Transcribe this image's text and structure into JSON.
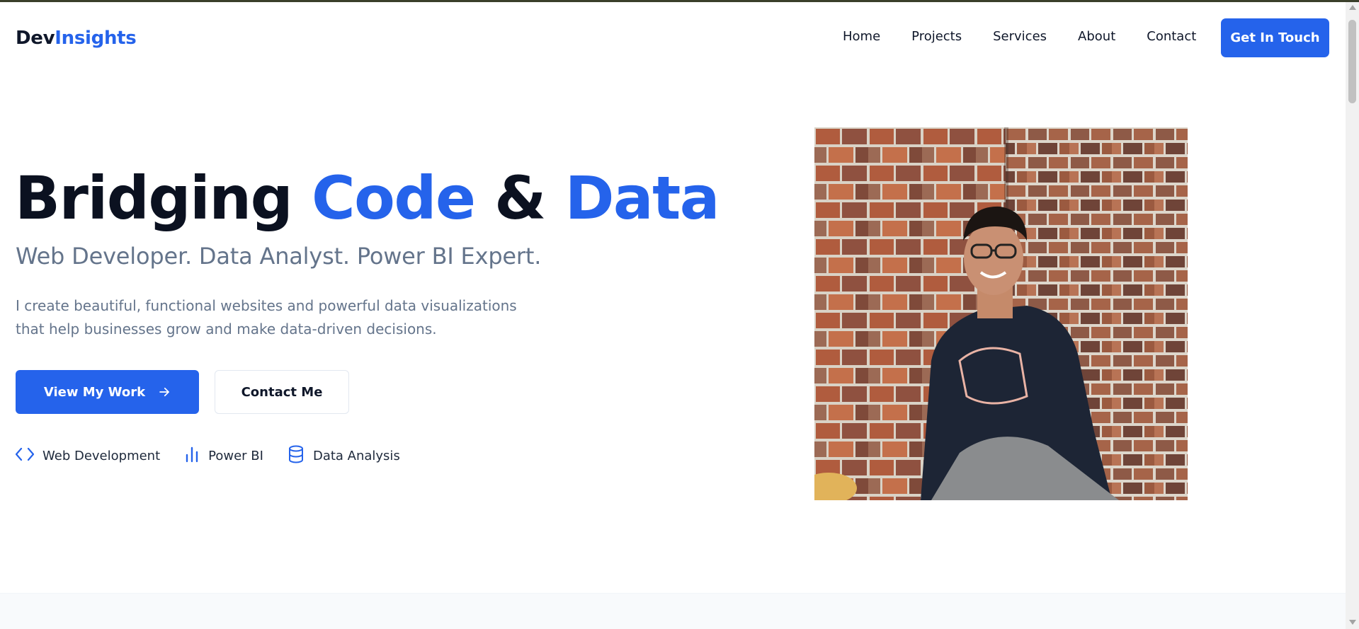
{
  "header": {
    "logo_part1": "Dev",
    "logo_part2": "Insights",
    "nav": [
      "Home",
      "Projects",
      "Services",
      "About",
      "Contact"
    ],
    "cta": "Get In Touch"
  },
  "hero": {
    "title_word1": "Bridging ",
    "title_word2": "Code",
    "title_word3": " & ",
    "title_word4": "Data",
    "subtitle": "Web Developer. Data Analyst. Power BI Expert.",
    "description": "I create beautiful, functional websites and powerful data visualizations that help businesses grow and make data-driven decisions.",
    "primary_button": "View My Work",
    "secondary_button": "Contact Me",
    "skills": [
      {
        "label": "Web Development",
        "icon": "code-icon"
      },
      {
        "label": "Power BI",
        "icon": "bar-chart-icon"
      },
      {
        "label": "Data Analysis",
        "icon": "database-icon"
      }
    ]
  },
  "colors": {
    "accent": "#2563eb",
    "text_dark": "#0f172a",
    "text_muted": "#64748b"
  }
}
